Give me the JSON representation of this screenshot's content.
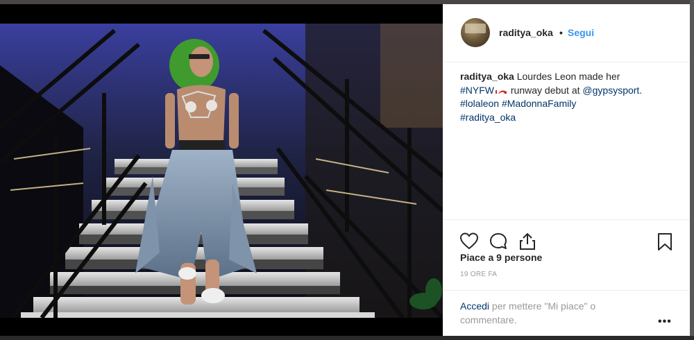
{
  "post": {
    "username": "raditya_oka",
    "separator": "•",
    "follow_label": "Segui",
    "caption": {
      "username": "raditya_oka",
      "text_before": "Lourdes Leon made her",
      "tag_nyfw": "#NYFW",
      "text_mid": "runway debut at",
      "mention": "@gypsysport",
      "text_after": ".",
      "tag_lolaleon": "#lolaleon",
      "tag_madonna": "#MadonnaFamily",
      "tag_raditya": "#raditya_oka"
    },
    "likes_text": "Piace a 9 persone",
    "time_text": "19 ORE FA",
    "login_link": "Accedi",
    "login_text": "per mettere \"Mi piace\" o commentare.",
    "more_label": "•••"
  },
  "icons": {
    "like": "heart-icon",
    "comment": "comment-icon",
    "share": "share-icon",
    "save": "bookmark-icon",
    "emoji": "high-heel-emoji"
  },
  "colors": {
    "link_blue": "#3897f0",
    "hashtag": "#003569",
    "text": "#262626",
    "muted": "#999999"
  }
}
